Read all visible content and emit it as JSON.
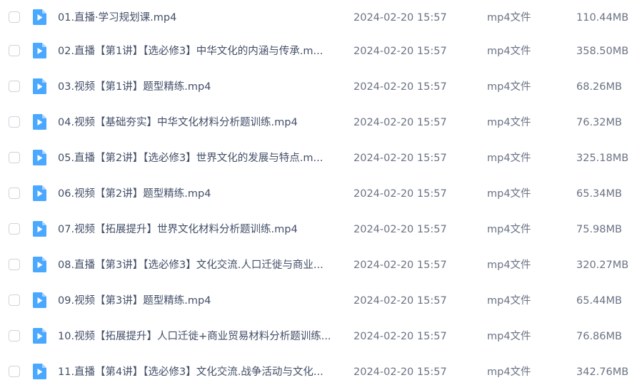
{
  "colors": {
    "icon_blue": "#4aa8ff",
    "icon_fold": "#a9d4ff",
    "play_white": "#ffffff"
  },
  "file_icon": "video-file-icon",
  "files": [
    {
      "name": "01.直播·学习规划课.mp4",
      "date": "2024-02-20 15:57",
      "type": "mp4文件",
      "size": "110.44MB"
    },
    {
      "name": "02.直播【第1讲】【选必修3】中华文化的内涵与传承.m...",
      "date": "2024-02-20 15:57",
      "type": "mp4文件",
      "size": "358.50MB"
    },
    {
      "name": "03.视频【第1讲】题型精练.mp4",
      "date": "2024-02-20 15:57",
      "type": "mp4文件",
      "size": "68.26MB"
    },
    {
      "name": "04.视频【基础夯实】中华文化材料分析题训练.mp4",
      "date": "2024-02-20 15:57",
      "type": "mp4文件",
      "size": "76.32MB"
    },
    {
      "name": "05.直播【第2讲】【选必修3】世界文化的发展与特点.m...",
      "date": "2024-02-20 15:57",
      "type": "mp4文件",
      "size": "325.18MB"
    },
    {
      "name": "06.视频【第2讲】题型精练.mp4",
      "date": "2024-02-20 15:57",
      "type": "mp4文件",
      "size": "65.34MB"
    },
    {
      "name": "07.视频【拓展提升】世界文化材料分析题训练.mp4",
      "date": "2024-02-20 15:57",
      "type": "mp4文件",
      "size": "75.98MB"
    },
    {
      "name": "08.直播【第3讲】【选必修3】文化交流.人口迁徙与商业...",
      "date": "2024-02-20 15:57",
      "type": "mp4文件",
      "size": "320.27MB"
    },
    {
      "name": "09.视频【第3讲】题型精练.mp4",
      "date": "2024-02-20 15:57",
      "type": "mp4文件",
      "size": "65.44MB"
    },
    {
      "name": "10.视频【拓展提升】人口迁徙+商业贸易材料分析题训练...",
      "date": "2024-02-20 15:57",
      "type": "mp4文件",
      "size": "76.86MB"
    },
    {
      "name": "11.直播【第4讲】【选必修3】文化交流.战争活动与文化...",
      "date": "2024-02-20 15:57",
      "type": "mp4文件",
      "size": "342.76MB"
    }
  ]
}
